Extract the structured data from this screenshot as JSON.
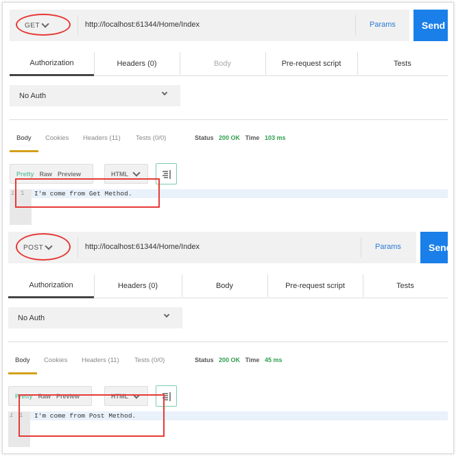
{
  "colors": {
    "send": "#1a7fe8",
    "params": "#2a7ad5",
    "status_ok": "#2e9e4f",
    "active_response_tab": "#d4a017",
    "annotation": "#e53935"
  },
  "panels": [
    {
      "method": "GET",
      "url": "http://localhost:61344/Home/Index",
      "params_label": "Params",
      "send_label": "Send",
      "request_tabs": [
        "Authorization",
        "Headers (0)",
        "Body",
        "Pre-request script",
        "Tests"
      ],
      "auth_value": "No Auth",
      "response_tabs": [
        "Body",
        "Cookies",
        "Headers (11)",
        "Tests (0/0)"
      ],
      "status_label": "Status",
      "status_value": "200 OK",
      "time_label": "Time",
      "time_value": "103 ms",
      "view_modes": [
        "Pretty",
        "Raw",
        "Preview"
      ],
      "format": "HTML",
      "line_number": "1",
      "response_text": "I'm come from Get Method."
    },
    {
      "method": "POST",
      "url": "http://localhost:61344/Home/Index",
      "params_label": "Params",
      "send_label": "Send",
      "request_tabs": [
        "Authorization",
        "Headers (0)",
        "Body",
        "Pre-request script",
        "Tests"
      ],
      "auth_value": "No Auth",
      "response_tabs": [
        "Body",
        "Cookies",
        "Headers (11)",
        "Tests (0/0)"
      ],
      "status_label": "Status",
      "status_value": "200 OK",
      "time_label": "Time",
      "time_value": "45 ms",
      "view_modes": [
        "Pretty",
        "Raw",
        "Preview"
      ],
      "format": "HTML",
      "line_number": "1",
      "response_text": "I'm come from Post Method."
    }
  ]
}
